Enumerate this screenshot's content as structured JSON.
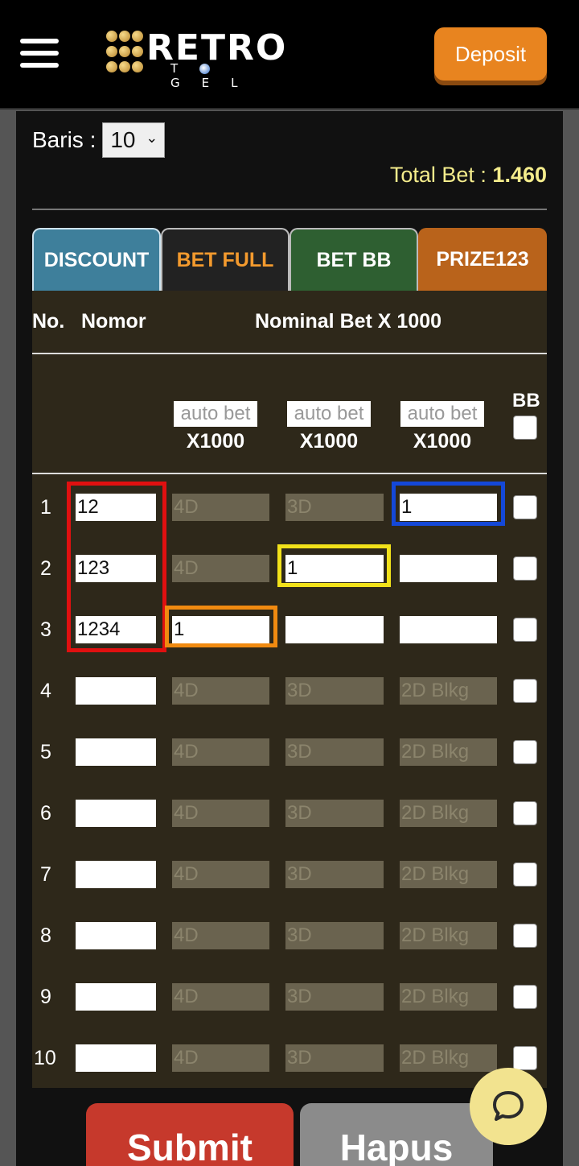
{
  "header": {
    "menu_icon": "hamburger-menu-icon",
    "logo_text": "RETRO",
    "logo_subtext": "TOGEL",
    "deposit_label": "Deposit"
  },
  "form": {
    "baris_label": "Baris :",
    "baris_value": "10",
    "total_bet_label": "Total Bet :",
    "total_bet_value": "1.460"
  },
  "tabs": [
    {
      "label": "DISCOUNT",
      "active": false
    },
    {
      "label": "BET FULL",
      "active": true
    },
    {
      "label": "BET BB",
      "active": false
    },
    {
      "label": "PRIZE123",
      "active": false
    }
  ],
  "table": {
    "col_no": "No.",
    "col_nomor": "Nomor",
    "col_nominal": "Nominal Bet X 1000",
    "auto_bet_placeholder": "auto bet",
    "auto_bet_multiplier": "X1000",
    "bb_label": "BB",
    "placeholders": {
      "c4": "4D",
      "c3": "3D",
      "c2": "2D Blkg"
    },
    "rows": [
      {
        "no": "1",
        "nomor": "12",
        "c4": "",
        "c3": "",
        "c2": "1"
      },
      {
        "no": "2",
        "nomor": "123",
        "c4": "",
        "c3": "1",
        "c2": ""
      },
      {
        "no": "3",
        "nomor": "1234",
        "c4": "1",
        "c3": "",
        "c2": ""
      },
      {
        "no": "4",
        "nomor": "",
        "c4": "",
        "c3": "",
        "c2": ""
      },
      {
        "no": "5",
        "nomor": "",
        "c4": "",
        "c3": "",
        "c2": ""
      },
      {
        "no": "6",
        "nomor": "",
        "c4": "",
        "c3": "",
        "c2": ""
      },
      {
        "no": "7",
        "nomor": "",
        "c4": "",
        "c3": "",
        "c2": ""
      },
      {
        "no": "8",
        "nomor": "",
        "c4": "",
        "c3": "",
        "c2": ""
      },
      {
        "no": "9",
        "nomor": "",
        "c4": "",
        "c3": "",
        "c2": ""
      },
      {
        "no": "10",
        "nomor": "",
        "c4": "",
        "c3": "",
        "c2": ""
      }
    ]
  },
  "actions": {
    "submit_label": "Submit",
    "hapus_label": "Hapus"
  },
  "colors": {
    "highlight_red": "#e01010",
    "highlight_orange": "#f08a10",
    "highlight_yellow": "#f2e21a",
    "highlight_blue": "#1448d8",
    "total_bet": "#f4ec8c",
    "tab_discount": "#3e7f9b",
    "tab_betfull_text": "#f39a2e",
    "tab_betbb": "#2e5f31",
    "tab_prize": "#b9631b"
  }
}
